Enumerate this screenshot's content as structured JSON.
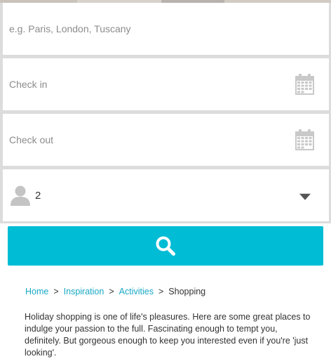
{
  "search": {
    "destination_placeholder": "e.g. Paris, London, Tuscany",
    "checkin_label": "Check in",
    "checkout_label": "Check out",
    "guests_value": "2",
    "calendar_icon": "calendar-icon",
    "person_icon": "person-icon",
    "dropdown_icon": "chevron-down-icon",
    "search_icon": "search-icon",
    "button_color": "#00bcd4"
  },
  "breadcrumb": {
    "items": [
      {
        "label": "Home"
      },
      {
        "label": "Inspiration"
      },
      {
        "label": "Activities"
      }
    ],
    "separator": ">",
    "current": "Shopping",
    "link_color": "#17a9c4"
  },
  "intro": {
    "text": "Holiday shopping is one of life's pleasures. Here are some great places to indulge your passion to the full. Fascinating enough to tempt you, definitely. But gorgeous enough to keep you interested even if you're 'just looking'."
  }
}
